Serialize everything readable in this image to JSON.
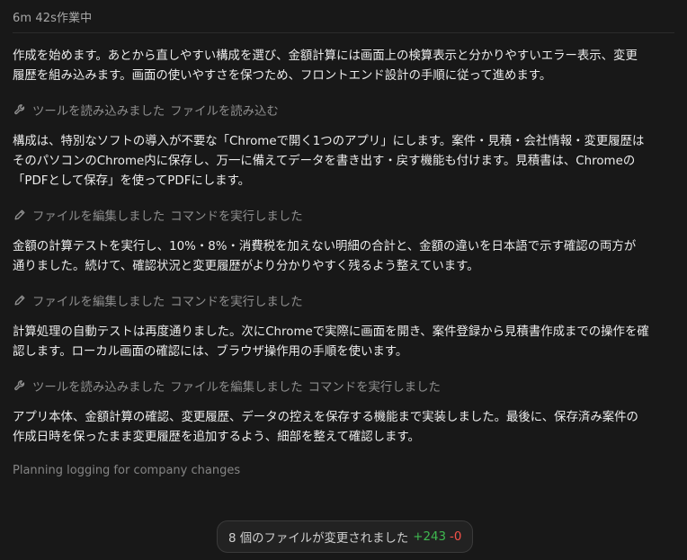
{
  "header": {
    "title": "6m 42s作業中"
  },
  "log": {
    "para1": "作成を始めます。あとから直しやすい構成を選び、金額計算には画面上の検算表示と分かりやすいエラー表示、変更\n履歴を組み込みます。画面の使いやすさを保つため、フロントエンド設計の手順に従って進めます。",
    "step1": {
      "icon": "wrench-icon",
      "actions": [
        "ツールを読み込みました",
        "ファイルを読み込む"
      ]
    },
    "para2": "構成は、特別なソフトの導入が不要な「Chromeで開く1つのアプリ」にします。案件・見積・会社情報・変更履歴は\nそのパソコンのChrome内に保存し、万一に備えてデータを書き出す・戻す機能も付けます。見積書は、Chromeの\n「PDFとして保存」を使ってPDFにします。",
    "step2": {
      "icon": "pencil-icon",
      "actions": [
        "ファイルを編集しました",
        "コマンドを実行しました"
      ]
    },
    "para3": "金額の計算テストを実行し、10%・8%・消費税を加えない明細の合計と、金額の違いを日本語で示す確認の両方が\n通りました。続けて、確認状況と変更履歴がより分かりやすく残るよう整えています。",
    "step3": {
      "icon": "pencil-icon",
      "actions": [
        "ファイルを編集しました",
        "コマンドを実行しました"
      ]
    },
    "para4": "計算処理の自動テストは再度通りました。次にChromeで実際に画面を開き、案件登録から見積書作成までの操作を確\n認します。ローカル画面の確認には、ブラウザ操作用の手順を使います。",
    "step4": {
      "icon": "wrench-icon",
      "actions": [
        "ツールを読み込みました",
        "ファイルを編集しました",
        "コマンドを実行しました"
      ]
    },
    "para5": "アプリ本体、金額計算の確認、変更履歴、データの控えを保存する機能まで実装しました。最後に、保存済み案件の\n作成日時を保ったまま変更履歴を追加するよう、細部を整えて確認します。",
    "status": "Planning logging for company changes"
  },
  "changes": {
    "label": "8 個のファイルが変更されました",
    "added": "+243",
    "removed": "-0"
  },
  "colors": {
    "added": "#3fb950",
    "removed": "#f85149"
  }
}
